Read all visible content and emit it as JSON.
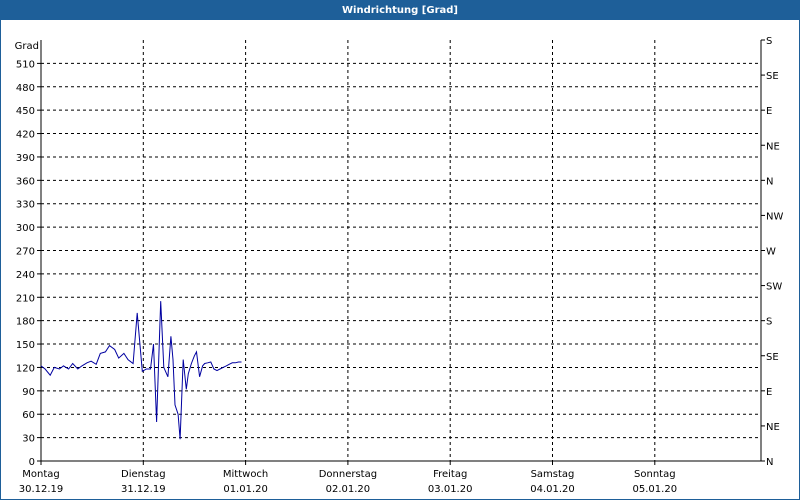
{
  "title": "Windrichtung [Grad]",
  "chart_data": {
    "type": "line",
    "title": "Windrichtung [Grad]",
    "ylabel": "Grad",
    "ylim": [
      0,
      540
    ],
    "yticks": [
      0,
      30,
      60,
      90,
      120,
      150,
      180,
      210,
      240,
      270,
      300,
      330,
      360,
      390,
      420,
      450,
      480,
      510
    ],
    "right_axis_labels": [
      {
        "value": 0,
        "label": "N"
      },
      {
        "value": 45,
        "label": "NE"
      },
      {
        "value": 90,
        "label": "E"
      },
      {
        "value": 135,
        "label": "SE"
      },
      {
        "value": 180,
        "label": "S"
      },
      {
        "value": 225,
        "label": "SW"
      },
      {
        "value": 270,
        "label": "W"
      },
      {
        "value": 315,
        "label": "NW"
      },
      {
        "value": 360,
        "label": "N"
      },
      {
        "value": 405,
        "label": "NE"
      },
      {
        "value": 450,
        "label": "E"
      },
      {
        "value": 495,
        "label": "SE"
      },
      {
        "value": 540,
        "label": "S"
      }
    ],
    "xlim": [
      0,
      7
    ],
    "x_days": [
      {
        "day": "Montag",
        "date": "30.12.19"
      },
      {
        "day": "Dienstag",
        "date": "31.12.19"
      },
      {
        "day": "Mittwoch",
        "date": "01.01.20"
      },
      {
        "day": "Donnerstag",
        "date": "02.01.20"
      },
      {
        "day": "Freitag",
        "date": "03.01.20"
      },
      {
        "day": "Samstag",
        "date": "04.01.20"
      },
      {
        "day": "Sonntag",
        "date": "05.01.20"
      }
    ],
    "grid": true,
    "line_color": "#0000a0",
    "series": [
      {
        "x": [
          0.0,
          0.04,
          0.09,
          0.13,
          0.18,
          0.22,
          0.27,
          0.31,
          0.36,
          0.4,
          0.45,
          0.49,
          0.54,
          0.58,
          0.63,
          0.67,
          0.72,
          0.76,
          0.81,
          0.85,
          0.9,
          0.94,
          0.99,
          1.03,
          1.07,
          1.1,
          1.13,
          1.17,
          1.2,
          1.24,
          1.27,
          1.29,
          1.31,
          1.34,
          1.36,
          1.39,
          1.42,
          1.44,
          1.47,
          1.5,
          1.52,
          1.55,
          1.58,
          1.6,
          1.63,
          1.66,
          1.69,
          1.72,
          1.75,
          1.78,
          1.81,
          1.84,
          1.87,
          1.9,
          1.93,
          1.96
        ],
        "y": [
          122,
          118,
          110,
          120,
          118,
          122,
          118,
          125,
          118,
          122,
          126,
          128,
          124,
          138,
          140,
          148,
          143,
          132,
          138,
          130,
          125,
          190,
          115,
          118,
          118,
          150,
          50,
          205,
          120,
          108,
          160,
          130,
          72,
          60,
          28,
          130,
          92,
          112,
          125,
          135,
          140,
          108,
          122,
          125,
          126,
          127,
          118,
          116,
          118,
          120,
          122,
          124,
          126,
          126,
          127,
          127
        ]
      }
    ]
  }
}
